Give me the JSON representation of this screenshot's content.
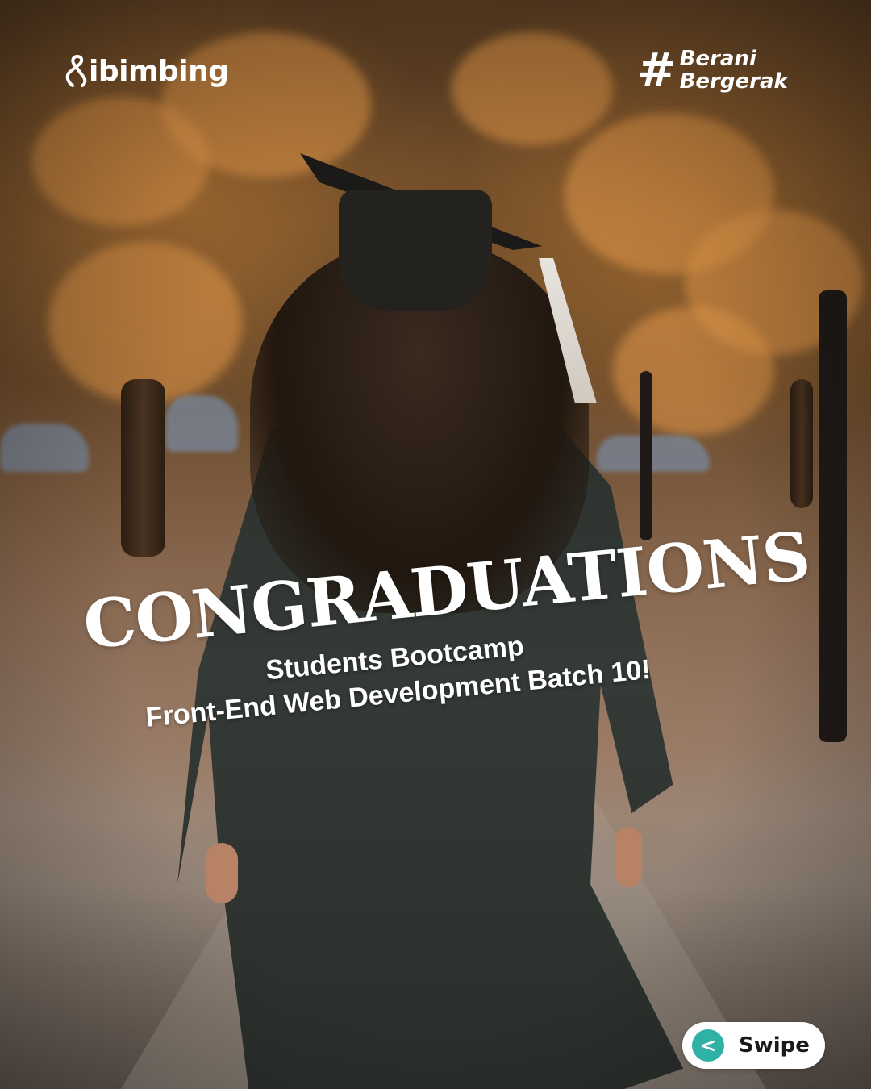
{
  "brand": {
    "name": "ibimbing"
  },
  "hashtag": {
    "symbol": "#",
    "line1": "Berani",
    "line2": "Bergerak"
  },
  "headline": {
    "title": "CONGRADUATIONS",
    "subtitle_line1": "Students Bootcamp",
    "subtitle_line2": "Front-End Web Development Batch 10!"
  },
  "swipe": {
    "icon_glyph": "<",
    "label": "Swipe",
    "accent_color": "#2fb1a6"
  }
}
